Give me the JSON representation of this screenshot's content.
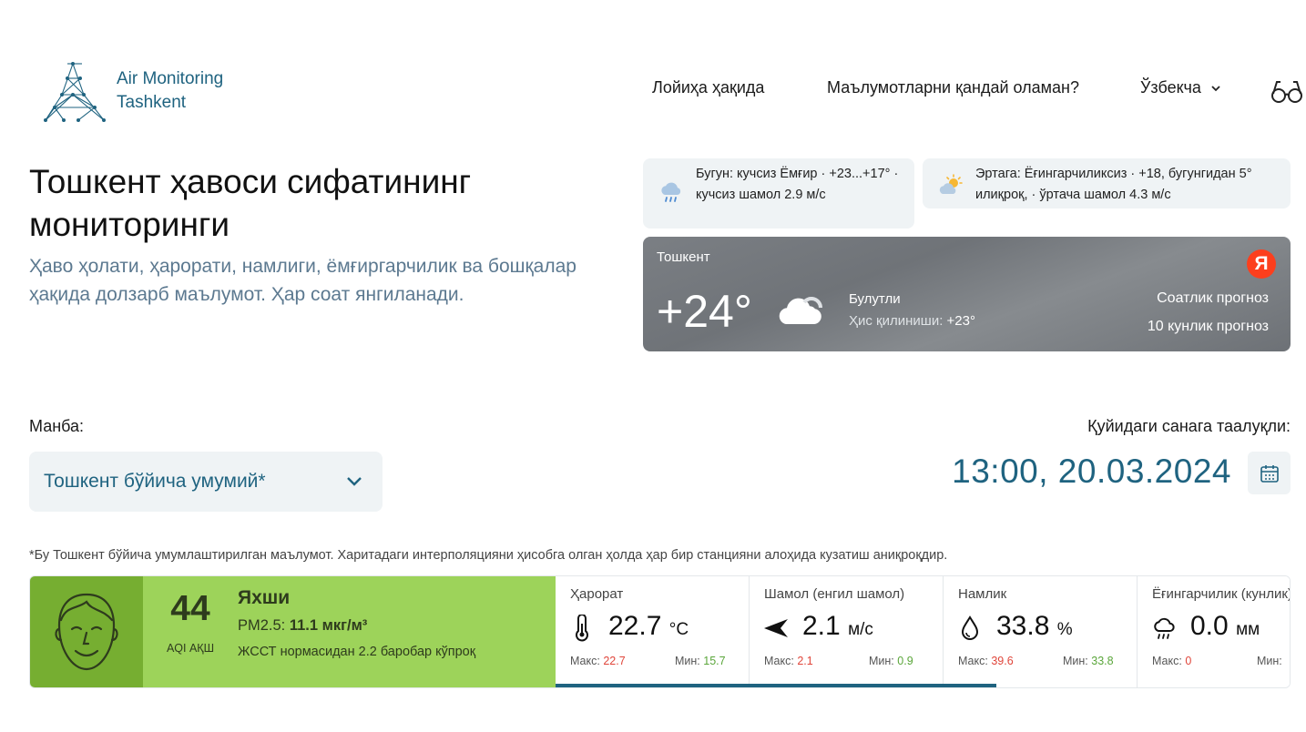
{
  "brand": {
    "line1": "Air Monitoring",
    "line2": "Tashkent"
  },
  "nav": {
    "about": "Лойиҳа ҳақида",
    "data_howto": "Маълумотларни қандай оламан?",
    "language": "Ўзбекча"
  },
  "hero": {
    "title": "Тошкент ҳавоси сифатининг мониторинги",
    "subtitle": "Ҳаво ҳолати, ҳарорати, намлиги, ёмғиргарчилик ва бошқалар ҳақида долзарб маълумот. Ҳар соат янгиланади."
  },
  "forecast": {
    "today": "Бугун: кучсиз Ёмғир · +23...+17° · кучсиз шамол 2.9 м/с",
    "tomorrow": "Эртага: Ёғингарчиликсиз · +18, бугунгидан 5° илиқроқ, · ўртача шамол 4.3 м/с"
  },
  "widget": {
    "city": "Тошкент",
    "temp": "+24°",
    "condition": "Булутли",
    "feels_label": "Ҳис қилиниши: ",
    "feels_value": "+23°",
    "hourly": "Соатлик прогноз",
    "tenday": "10 кунлик прогноз",
    "logo": "Я"
  },
  "source": {
    "label": "Манба:",
    "value": "Тошкент бўйича умумий*"
  },
  "date": {
    "label": "Қуйидаги санага таалуқли:",
    "value": "13:00, 20.03.2024"
  },
  "note": "*Бу Тошкент бўйича умумлаштирилган маълумот. Харитадаги интерполяцияни ҳисобга олган ҳолда ҳар бир станцияни алоҳида кузатиш аниқроқдир.",
  "aqi": {
    "value": "44",
    "label": "AQI АҚШ",
    "status": "Яхши",
    "pm_label": "PM2.5: ",
    "pm_value": "11.1 мкг/м³",
    "who": "ЖССТ нормасидан 2.2 баробар кўпроқ",
    "color_face": "#76ae31",
    "color_box": "#9dd35a"
  },
  "metrics": [
    {
      "title": "Ҳарорат",
      "value": "22.7",
      "unit": "°C",
      "max_label": "Макс:",
      "max": "22.7",
      "min_label": "Мин:",
      "min": "15.7",
      "icon": "thermometer-icon"
    },
    {
      "title": "Шамол (енгил шамол)",
      "value": "2.1",
      "unit": "м/с",
      "max_label": "Макс:",
      "max": "2.1",
      "min_label": "Мин:",
      "min": "0.9",
      "icon": "wind-arrow-icon"
    },
    {
      "title": "Намлик",
      "value": "33.8",
      "unit": "%",
      "max_label": "Макс:",
      "max": "39.6",
      "min_label": "Мин:",
      "min": "33.8",
      "icon": "droplet-icon"
    },
    {
      "title": "Ёғингарчилик (кунлик)",
      "value": "0.0",
      "unit": "мм",
      "max_label": "Макс:",
      "max": "0",
      "min_label": "Мин:",
      "min": "",
      "icon": "rain-cloud-icon"
    }
  ],
  "colors": {
    "accent": "#1f6380",
    "muted": "#5c7990",
    "panel": "#eff3f5"
  }
}
